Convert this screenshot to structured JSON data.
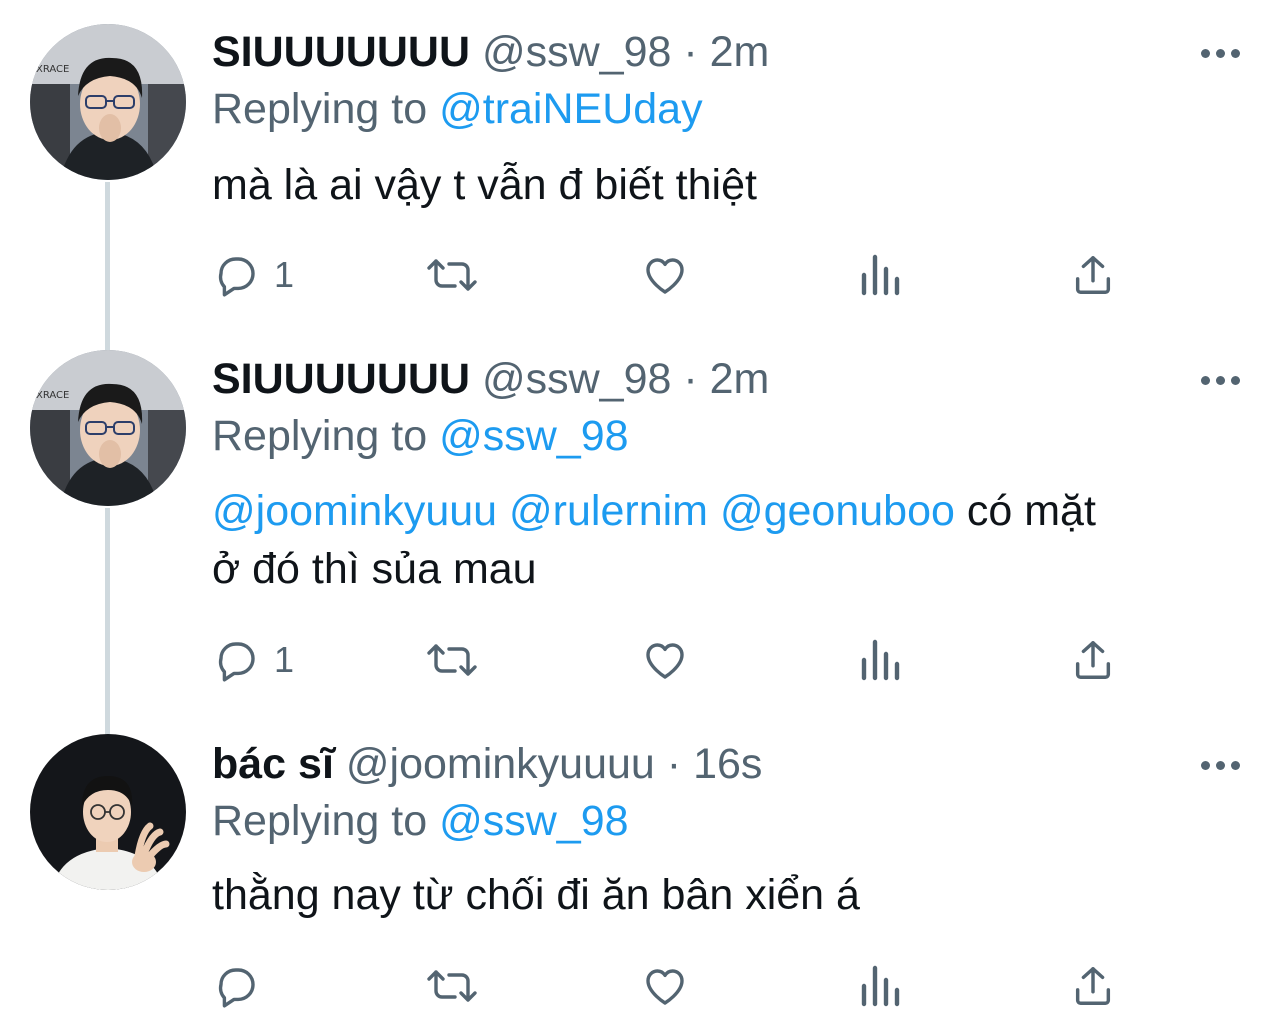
{
  "tweets": [
    {
      "display_name": "SIUUUUUUU",
      "handle": "@ssw_98",
      "dot": "·",
      "time": "2m",
      "replying_prefix": "Replying to",
      "replying_to": "@traiNEUday",
      "text": "mà là ai vậy t vẫn đ biết thiệt",
      "reply_count": "1",
      "avatar": "avatar-photo-icon"
    },
    {
      "display_name": "SIUUUUUUU",
      "handle": "@ssw_98",
      "dot": "·",
      "time": "2m",
      "replying_prefix": "Replying to",
      "replying_to": "@ssw_98",
      "mentions": [
        "@joominkyuuu",
        "@rulernim",
        "@geonuboo"
      ],
      "text_after_mentions": "có mặt",
      "text_line2": "ở đó thì sủa mau",
      "reply_count": "1",
      "avatar": "avatar-photo-icon"
    },
    {
      "display_name": "bác sĩ",
      "handle": "@joominkyuuuu",
      "dot": "·",
      "time": "16s",
      "replying_prefix": "Replying to",
      "replying_to": "@ssw_98",
      "text": "thằng nay từ chối đi ăn bân xiển á",
      "reply_count": "",
      "avatar": "avatar-photo-icon"
    }
  ],
  "icons": {
    "reply": "reply-icon",
    "retweet": "retweet-icon",
    "like": "heart-icon",
    "analytics": "analytics-icon",
    "share": "share-icon",
    "more": "more-icon"
  },
  "colors": {
    "accent": "#1d9bf0",
    "secondary_text": "#536471",
    "primary_text": "#0f1419",
    "thread_line": "#cfd9de"
  }
}
